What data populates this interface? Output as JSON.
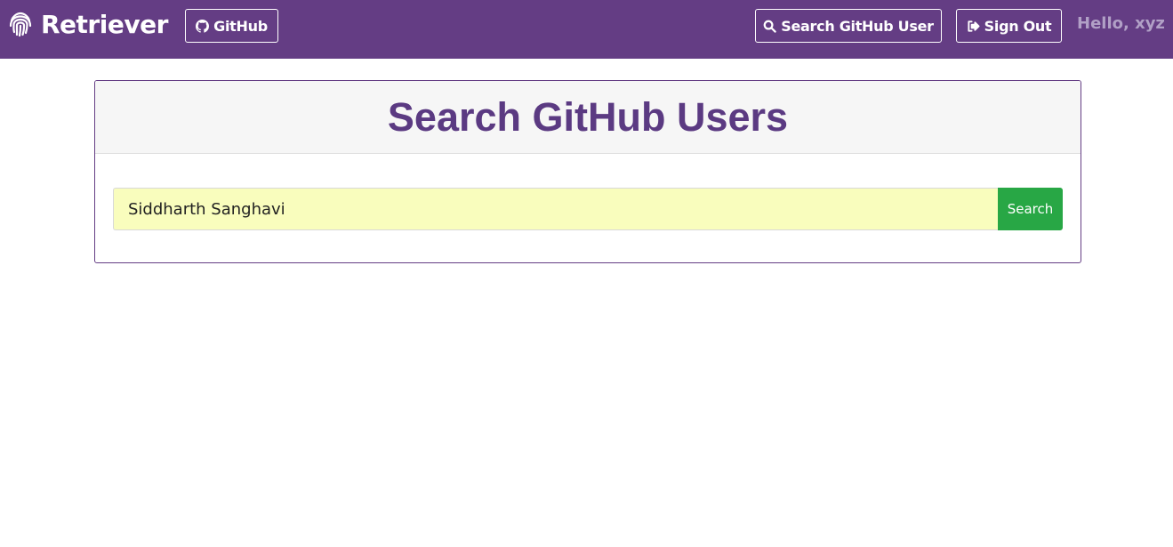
{
  "navbar": {
    "brand": {
      "icon": "fingerprint-icon",
      "label": "Retriever"
    },
    "github_button": {
      "icon": "github-icon",
      "label": "GitHub"
    },
    "search_user_button": {
      "icon": "search-icon",
      "label": "Search GitHub User"
    },
    "signout_button": {
      "icon": "sign-out-icon",
      "label": "Sign Out"
    },
    "greeting": "Hello, xyz"
  },
  "card": {
    "title": "Search GitHub Users",
    "search": {
      "value": "Siddharth Sanghavi",
      "button_label": "Search"
    }
  },
  "colors": {
    "navbar_bg": "#643d84",
    "title": "#5b3a82",
    "input_bg": "#f9fdbd",
    "search_button": "#28a745",
    "greeting": "#b1a0c6"
  }
}
